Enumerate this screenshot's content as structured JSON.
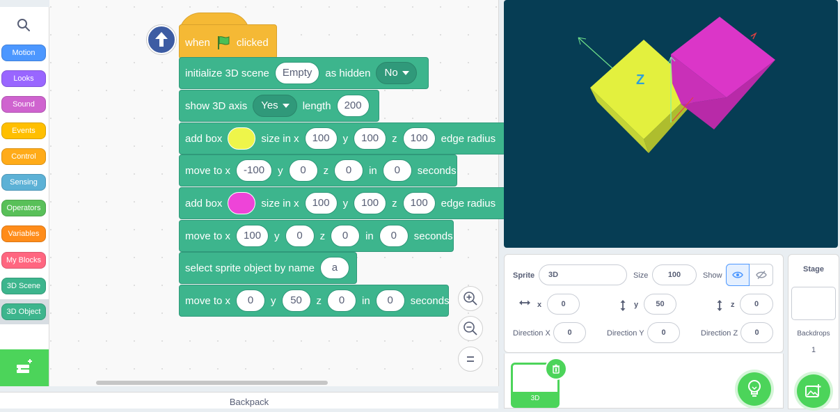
{
  "palette": {
    "categories": [
      {
        "label": "Motion",
        "color": "#4c97ff"
      },
      {
        "label": "Looks",
        "color": "#9966ff"
      },
      {
        "label": "Sound",
        "color": "#cf63cf"
      },
      {
        "label": "Events",
        "color": "#ffbf00"
      },
      {
        "label": "Control",
        "color": "#ffab19"
      },
      {
        "label": "Sensing",
        "color": "#5cb1d6"
      },
      {
        "label": "Operators",
        "color": "#59c059"
      },
      {
        "label": "Variables",
        "color": "#ff8c1a"
      },
      {
        "label": "My Blocks",
        "color": "#ff6680"
      },
      {
        "label": "3D Scene",
        "color": "#3db58d"
      },
      {
        "label": "3D Object",
        "color": "#3db58d"
      }
    ],
    "selected": "3D Object"
  },
  "script": {
    "hat": {
      "when": "when",
      "clicked": "clicked"
    },
    "init": {
      "text1": "initialize 3D scene",
      "scene": "Empty",
      "text2": "as hidden",
      "hidden": "No"
    },
    "axis": {
      "text1": "show 3D axis",
      "show": "Yes",
      "text2": "length",
      "length": "200"
    },
    "box1": {
      "text1": "add box",
      "color": "#eef54a",
      "text2": "size in x",
      "x": "100",
      "y_label": "y",
      "y": "100",
      "z_label": "z",
      "z": "100",
      "text3": "edge radius"
    },
    "move1": {
      "text1": "move to x",
      "x": "-100",
      "y_label": "y",
      "y": "0",
      "z_label": "z",
      "z": "0",
      "in_label": "in",
      "secs": "0",
      "seconds": "seconds"
    },
    "box2": {
      "text1": "add box",
      "color": "#ee44d8",
      "text2": "size in x",
      "x": "100",
      "y_label": "y",
      "y": "100",
      "z_label": "z",
      "z": "100",
      "text3": "edge radius"
    },
    "move2": {
      "text1": "move to x",
      "x": "100",
      "y_label": "y",
      "y": "0",
      "z_label": "z",
      "z": "0",
      "in_label": "in",
      "secs": "0",
      "seconds": "seconds"
    },
    "select": {
      "text1": "select sprite object by name",
      "name": "a"
    },
    "move3": {
      "text1": "move to x",
      "x": "0",
      "y_label": "y",
      "y": "50",
      "z_label": "z",
      "z": "0",
      "in_label": "in",
      "secs": "0",
      "seconds": "seconds"
    }
  },
  "backpack": "Backpack",
  "stage": {
    "background": "#063d54",
    "axis_label": "Z",
    "box1_color": "#e5f244",
    "box2_color": "#dc3cc8"
  },
  "sprite_info": {
    "sprite_label": "Sprite",
    "sprite_name": "3D",
    "size_label": "Size",
    "size": "100",
    "show_label": "Show",
    "x_label": "x",
    "x": "0",
    "y_label": "y",
    "y": "50",
    "z_label": "z",
    "z": "0",
    "dirx_label": "Direction X",
    "dirx": "0",
    "diry_label": "Direction Y",
    "diry": "0",
    "dirz_label": "Direction Z",
    "dirz": "0"
  },
  "sprite_list": {
    "sprite_thumb_label": "3D"
  },
  "stage_panel": {
    "title": "Stage",
    "backdrops_label": "Backdrops",
    "backdrops_count": "1"
  }
}
